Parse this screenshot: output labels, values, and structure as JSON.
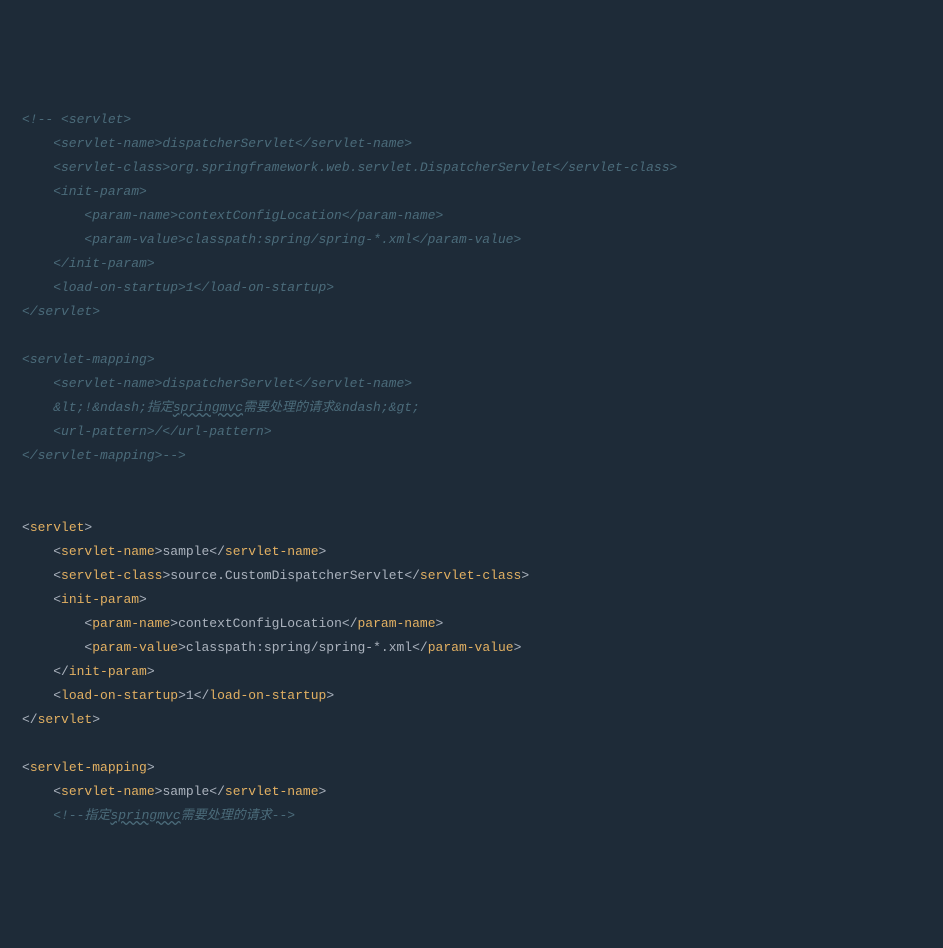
{
  "lines": [
    {
      "type": "comment",
      "indent": 0,
      "text": "<!-- <servlet>"
    },
    {
      "type": "comment",
      "indent": 1,
      "text": "<servlet-name>dispatcherServlet</servlet-name>"
    },
    {
      "type": "comment",
      "indent": 1,
      "text": "<servlet-class>org.springframework.web.servlet.DispatcherServlet</servlet-class>"
    },
    {
      "type": "comment",
      "indent": 1,
      "text": "<init-param>"
    },
    {
      "type": "comment",
      "indent": 2,
      "text": "<param-name>contextConfigLocation</param-name>"
    },
    {
      "type": "comment",
      "indent": 2,
      "text": "<param-value>classpath:spring/spring-*.xml</param-value>"
    },
    {
      "type": "comment",
      "indent": 1,
      "text": "</init-param>"
    },
    {
      "type": "comment",
      "indent": 1,
      "text": "<load-on-startup>1</load-on-startup>"
    },
    {
      "type": "comment",
      "indent": 0,
      "text": "</servlet>"
    },
    {
      "type": "blank"
    },
    {
      "type": "comment",
      "indent": 0,
      "text": "<servlet-mapping>"
    },
    {
      "type": "comment",
      "indent": 1,
      "text": "<servlet-name>dispatcherServlet</servlet-name>"
    },
    {
      "type": "comment-underline",
      "indent": 1,
      "prefix": "&lt;!&ndash;指定",
      "underlined": "springmvc",
      "suffix": "需要处理的请求&ndash;&gt;"
    },
    {
      "type": "comment",
      "indent": 1,
      "text": "<url-pattern>/</url-pattern>"
    },
    {
      "type": "comment",
      "indent": 0,
      "text": "</servlet-mapping>-->"
    },
    {
      "type": "blank"
    },
    {
      "type": "blank"
    },
    {
      "type": "open",
      "indent": 0,
      "tag": "servlet"
    },
    {
      "type": "full",
      "indent": 1,
      "tag": "servlet-name",
      "content": "sample"
    },
    {
      "type": "full",
      "indent": 1,
      "tag": "servlet-class",
      "content": "source.CustomDispatcherServlet"
    },
    {
      "type": "open",
      "indent": 1,
      "tag": "init-param"
    },
    {
      "type": "full",
      "indent": 2,
      "tag": "param-name",
      "content": "contextConfigLocation"
    },
    {
      "type": "full",
      "indent": 2,
      "tag": "param-value",
      "content": "classpath:spring/spring-*.xml"
    },
    {
      "type": "close",
      "indent": 1,
      "tag": "init-param"
    },
    {
      "type": "full",
      "indent": 1,
      "tag": "load-on-startup",
      "content": "1"
    },
    {
      "type": "close",
      "indent": 0,
      "tag": "servlet"
    },
    {
      "type": "blank"
    },
    {
      "type": "open",
      "indent": 0,
      "tag": "servlet-mapping"
    },
    {
      "type": "full",
      "indent": 1,
      "tag": "servlet-name",
      "content": "sample"
    },
    {
      "type": "comment-underline",
      "indent": 1,
      "prefix": "<!--指定",
      "underlined": "springmvc",
      "suffix": "需要处理的请求-->"
    }
  ]
}
